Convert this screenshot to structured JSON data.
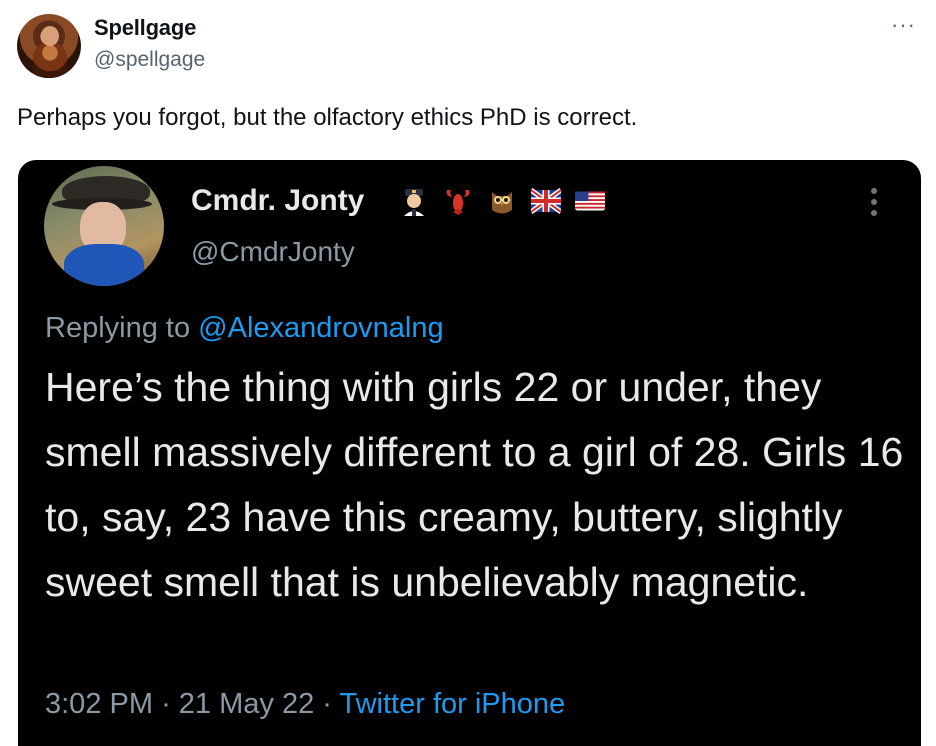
{
  "tweet": {
    "author_name": "Spellgage",
    "author_handle": "@spellgage",
    "text": "Perhaps you forgot, but the olfactory ethics PhD is correct.",
    "more_label": "···"
  },
  "quoted_tweet": {
    "author_name": "Cmdr. Jonty",
    "author_handle": "@CmdrJonty",
    "name_emojis": [
      "pilot-emoji",
      "lobster-emoji",
      "owl-emoji",
      "uk-flag-emoji",
      "us-flag-emoji"
    ],
    "replying_prefix": "Replying to",
    "replying_to": "@Alexandrovnalng",
    "body": "Here’s the thing with girls 22 or under, they smell massively different to a girl of 28. Girls 16 to, say, 23 have this creamy, buttery,  slightly sweet smell that is unbelievably magnetic.",
    "time": "3:02 PM",
    "date": "21 May 22",
    "separator": "·",
    "source": "Twitter for iPhone"
  },
  "colors": {
    "card_background": "#000000",
    "link_blue": "#1d9bf0",
    "secondary_text": "#8b98a5"
  }
}
